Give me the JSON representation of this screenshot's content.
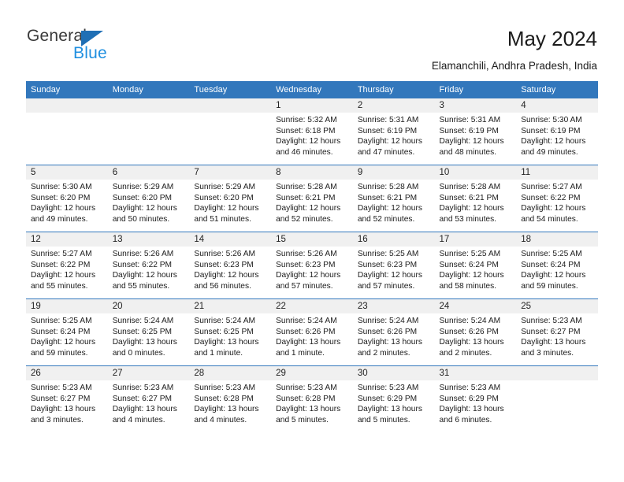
{
  "brand": {
    "name_top": "General",
    "name_bottom": "Blue",
    "triangle_color": "#1f6fb5",
    "blue_text_color": "#1f8fe0"
  },
  "header": {
    "title": "May 2024",
    "subtitle": "Elamanchili, Andhra Pradesh, India"
  },
  "theme": {
    "header_blue": "#3277bc",
    "daynum_band": "#f0f0f0",
    "row_rule": "#3277bc"
  },
  "weekday_headers": [
    "Sunday",
    "Monday",
    "Tuesday",
    "Wednesday",
    "Thursday",
    "Friday",
    "Saturday"
  ],
  "labels": {
    "sunrise_prefix": "Sunrise:",
    "sunset_prefix": "Sunset:",
    "daylight_prefix": "Daylight:"
  },
  "weeks": [
    [
      {
        "day": "",
        "sunrise": "",
        "sunset": "",
        "daylight_line1": "",
        "daylight_line2": ""
      },
      {
        "day": "",
        "sunrise": "",
        "sunset": "",
        "daylight_line1": "",
        "daylight_line2": ""
      },
      {
        "day": "",
        "sunrise": "",
        "sunset": "",
        "daylight_line1": "",
        "daylight_line2": ""
      },
      {
        "day": "1",
        "sunrise": "Sunrise: 5:32 AM",
        "sunset": "Sunset: 6:18 PM",
        "daylight_line1": "Daylight: 12 hours",
        "daylight_line2": "and 46 minutes."
      },
      {
        "day": "2",
        "sunrise": "Sunrise: 5:31 AM",
        "sunset": "Sunset: 6:19 PM",
        "daylight_line1": "Daylight: 12 hours",
        "daylight_line2": "and 47 minutes."
      },
      {
        "day": "3",
        "sunrise": "Sunrise: 5:31 AM",
        "sunset": "Sunset: 6:19 PM",
        "daylight_line1": "Daylight: 12 hours",
        "daylight_line2": "and 48 minutes."
      },
      {
        "day": "4",
        "sunrise": "Sunrise: 5:30 AM",
        "sunset": "Sunset: 6:19 PM",
        "daylight_line1": "Daylight: 12 hours",
        "daylight_line2": "and 49 minutes."
      }
    ],
    [
      {
        "day": "5",
        "sunrise": "Sunrise: 5:30 AM",
        "sunset": "Sunset: 6:20 PM",
        "daylight_line1": "Daylight: 12 hours",
        "daylight_line2": "and 49 minutes."
      },
      {
        "day": "6",
        "sunrise": "Sunrise: 5:29 AM",
        "sunset": "Sunset: 6:20 PM",
        "daylight_line1": "Daylight: 12 hours",
        "daylight_line2": "and 50 minutes."
      },
      {
        "day": "7",
        "sunrise": "Sunrise: 5:29 AM",
        "sunset": "Sunset: 6:20 PM",
        "daylight_line1": "Daylight: 12 hours",
        "daylight_line2": "and 51 minutes."
      },
      {
        "day": "8",
        "sunrise": "Sunrise: 5:28 AM",
        "sunset": "Sunset: 6:21 PM",
        "daylight_line1": "Daylight: 12 hours",
        "daylight_line2": "and 52 minutes."
      },
      {
        "day": "9",
        "sunrise": "Sunrise: 5:28 AM",
        "sunset": "Sunset: 6:21 PM",
        "daylight_line1": "Daylight: 12 hours",
        "daylight_line2": "and 52 minutes."
      },
      {
        "day": "10",
        "sunrise": "Sunrise: 5:28 AM",
        "sunset": "Sunset: 6:21 PM",
        "daylight_line1": "Daylight: 12 hours",
        "daylight_line2": "and 53 minutes."
      },
      {
        "day": "11",
        "sunrise": "Sunrise: 5:27 AM",
        "sunset": "Sunset: 6:22 PM",
        "daylight_line1": "Daylight: 12 hours",
        "daylight_line2": "and 54 minutes."
      }
    ],
    [
      {
        "day": "12",
        "sunrise": "Sunrise: 5:27 AM",
        "sunset": "Sunset: 6:22 PM",
        "daylight_line1": "Daylight: 12 hours",
        "daylight_line2": "and 55 minutes."
      },
      {
        "day": "13",
        "sunrise": "Sunrise: 5:26 AM",
        "sunset": "Sunset: 6:22 PM",
        "daylight_line1": "Daylight: 12 hours",
        "daylight_line2": "and 55 minutes."
      },
      {
        "day": "14",
        "sunrise": "Sunrise: 5:26 AM",
        "sunset": "Sunset: 6:23 PM",
        "daylight_line1": "Daylight: 12 hours",
        "daylight_line2": "and 56 minutes."
      },
      {
        "day": "15",
        "sunrise": "Sunrise: 5:26 AM",
        "sunset": "Sunset: 6:23 PM",
        "daylight_line1": "Daylight: 12 hours",
        "daylight_line2": "and 57 minutes."
      },
      {
        "day": "16",
        "sunrise": "Sunrise: 5:25 AM",
        "sunset": "Sunset: 6:23 PM",
        "daylight_line1": "Daylight: 12 hours",
        "daylight_line2": "and 57 minutes."
      },
      {
        "day": "17",
        "sunrise": "Sunrise: 5:25 AM",
        "sunset": "Sunset: 6:24 PM",
        "daylight_line1": "Daylight: 12 hours",
        "daylight_line2": "and 58 minutes."
      },
      {
        "day": "18",
        "sunrise": "Sunrise: 5:25 AM",
        "sunset": "Sunset: 6:24 PM",
        "daylight_line1": "Daylight: 12 hours",
        "daylight_line2": "and 59 minutes."
      }
    ],
    [
      {
        "day": "19",
        "sunrise": "Sunrise: 5:25 AM",
        "sunset": "Sunset: 6:24 PM",
        "daylight_line1": "Daylight: 12 hours",
        "daylight_line2": "and 59 minutes."
      },
      {
        "day": "20",
        "sunrise": "Sunrise: 5:24 AM",
        "sunset": "Sunset: 6:25 PM",
        "daylight_line1": "Daylight: 13 hours",
        "daylight_line2": "and 0 minutes."
      },
      {
        "day": "21",
        "sunrise": "Sunrise: 5:24 AM",
        "sunset": "Sunset: 6:25 PM",
        "daylight_line1": "Daylight: 13 hours",
        "daylight_line2": "and 1 minute."
      },
      {
        "day": "22",
        "sunrise": "Sunrise: 5:24 AM",
        "sunset": "Sunset: 6:26 PM",
        "daylight_line1": "Daylight: 13 hours",
        "daylight_line2": "and 1 minute."
      },
      {
        "day": "23",
        "sunrise": "Sunrise: 5:24 AM",
        "sunset": "Sunset: 6:26 PM",
        "daylight_line1": "Daylight: 13 hours",
        "daylight_line2": "and 2 minutes."
      },
      {
        "day": "24",
        "sunrise": "Sunrise: 5:24 AM",
        "sunset": "Sunset: 6:26 PM",
        "daylight_line1": "Daylight: 13 hours",
        "daylight_line2": "and 2 minutes."
      },
      {
        "day": "25",
        "sunrise": "Sunrise: 5:23 AM",
        "sunset": "Sunset: 6:27 PM",
        "daylight_line1": "Daylight: 13 hours",
        "daylight_line2": "and 3 minutes."
      }
    ],
    [
      {
        "day": "26",
        "sunrise": "Sunrise: 5:23 AM",
        "sunset": "Sunset: 6:27 PM",
        "daylight_line1": "Daylight: 13 hours",
        "daylight_line2": "and 3 minutes."
      },
      {
        "day": "27",
        "sunrise": "Sunrise: 5:23 AM",
        "sunset": "Sunset: 6:27 PM",
        "daylight_line1": "Daylight: 13 hours",
        "daylight_line2": "and 4 minutes."
      },
      {
        "day": "28",
        "sunrise": "Sunrise: 5:23 AM",
        "sunset": "Sunset: 6:28 PM",
        "daylight_line1": "Daylight: 13 hours",
        "daylight_line2": "and 4 minutes."
      },
      {
        "day": "29",
        "sunrise": "Sunrise: 5:23 AM",
        "sunset": "Sunset: 6:28 PM",
        "daylight_line1": "Daylight: 13 hours",
        "daylight_line2": "and 5 minutes."
      },
      {
        "day": "30",
        "sunrise": "Sunrise: 5:23 AM",
        "sunset": "Sunset: 6:29 PM",
        "daylight_line1": "Daylight: 13 hours",
        "daylight_line2": "and 5 minutes."
      },
      {
        "day": "31",
        "sunrise": "Sunrise: 5:23 AM",
        "sunset": "Sunset: 6:29 PM",
        "daylight_line1": "Daylight: 13 hours",
        "daylight_line2": "and 6 minutes."
      },
      {
        "day": "",
        "sunrise": "",
        "sunset": "",
        "daylight_line1": "",
        "daylight_line2": ""
      }
    ]
  ]
}
